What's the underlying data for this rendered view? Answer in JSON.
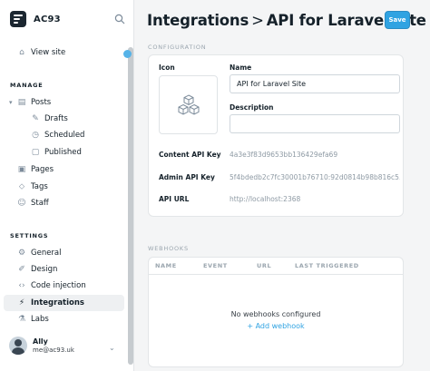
{
  "sidebar": {
    "site_name": "AC93",
    "view_site": "View site",
    "manage_title": "MANAGE",
    "settings_title": "SETTINGS",
    "items": {
      "posts": "Posts",
      "drafts": "Drafts",
      "scheduled": "Scheduled",
      "published": "Published",
      "pages": "Pages",
      "tags": "Tags",
      "staff": "Staff",
      "general": "General",
      "design": "Design",
      "code_injection": "Code injection",
      "integrations": "Integrations",
      "labs": "Labs"
    },
    "user": {
      "name": "Ally",
      "email": "me@ac93.uk"
    }
  },
  "header": {
    "breadcrumb_parent": "Integrations",
    "separator": ">",
    "current": "API for Laravel Site",
    "save_label": "Save"
  },
  "configuration": {
    "section_title": "CONFIGURATION",
    "icon_label": "Icon",
    "name_label": "Name",
    "name_value": "API for Laravel Site",
    "description_label": "Description",
    "description_value": "",
    "content_api_key_label": "Content API Key",
    "content_api_key_value": "4a3e3f83d9653bb136429efa69",
    "admin_api_key_label": "Admin API Key",
    "admin_api_key_value": "5f4bdedb2c7fc30001b76710:92d0814b98b816c5...",
    "api_url_label": "API URL",
    "api_url_value": "http://localhost:2368"
  },
  "webhooks": {
    "section_title": "WEBHOOKS",
    "columns": [
      "NAME",
      "EVENT",
      "URL",
      "LAST TRIGGERED"
    ],
    "empty_text": "No webhooks configured",
    "add_label": "+ Add webhook"
  },
  "colors": {
    "accent": "#30a3e2",
    "sidebar_active": "#eef0f2",
    "background": "#f4f5f6"
  }
}
